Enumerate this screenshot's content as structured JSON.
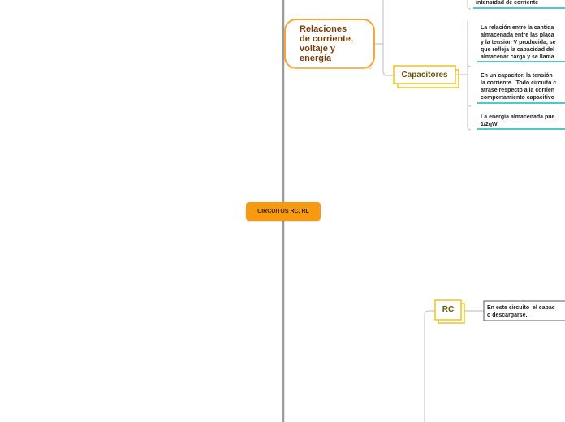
{
  "central": {
    "title": "CIRCUITOS RC, RL"
  },
  "branches": {
    "relaciones": {
      "label": "Relaciones\nde corriente,\nvoltaje y\nenergía"
    },
    "capacitores": {
      "label": "Capacitores",
      "leaves": [
        "intensidad de corriente",
        "La relación entre la cantida\nalmacenada entre las placa\ny la tensión V producida, se\nque refleja la capacidad del\nalmacenar carga y se llama",
        "En un capacitor, la tensión \nla corriente.  Todo circuito c\natrase respecto a la corrien\ncomportamiento capacitivo",
        "La energía almacenada pue\n1/2qW"
      ]
    },
    "rc": {
      "label": "RC",
      "leaves": [
        "En este circuito  el capac\no descargarse."
      ]
    }
  },
  "colors": {
    "central": "#f79a12",
    "relaciones_border": "#f7a53a",
    "capacitores_border": "#f3c21a",
    "leaf_underline": "#1bb3b8",
    "trunk": "#9a9a9a",
    "branch_line": "#c8c8c8"
  }
}
